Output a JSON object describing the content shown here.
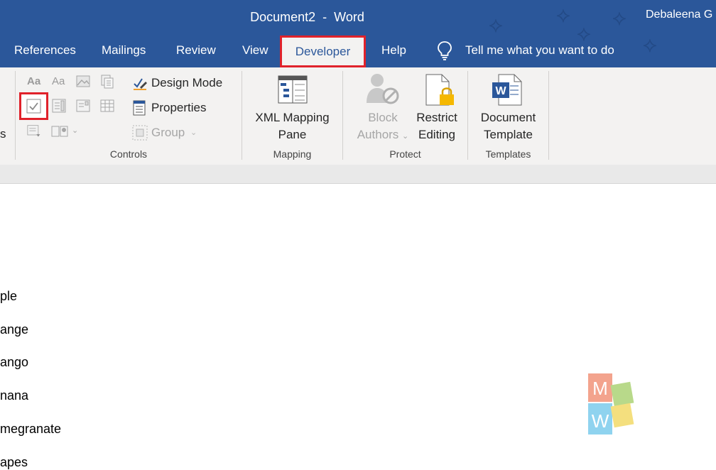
{
  "titlebar": {
    "document_title": "Document2  -  Word",
    "user": "Debaleena G"
  },
  "tabs": [
    "References",
    "Mailings",
    "Review",
    "View",
    "Developer",
    "Help"
  ],
  "active_tab": "Developer",
  "tell_me": "Tell me what you want to do",
  "ribbon": {
    "controls": {
      "label": "Controls",
      "design_mode": "Design Mode",
      "properties": "Properties",
      "group": "Group",
      "rich_text_label": "Aa",
      "plain_text_label": "Aa",
      "left_edge_text": "s"
    },
    "mapping": {
      "label": "Mapping",
      "xml_line1": "XML Mapping",
      "xml_line2": "Pane"
    },
    "protect": {
      "label": "Protect",
      "block_line1": "Block",
      "block_line2": "Authors",
      "restrict_line1": "Restrict",
      "restrict_line2": "Editing"
    },
    "templates": {
      "label": "Templates",
      "doc_line1": "Document",
      "doc_line2": "Template"
    }
  },
  "document": {
    "lines": [
      "ple",
      "ange",
      "ango",
      "nana",
      "megranate",
      "apes"
    ]
  },
  "watermark": {
    "letter1": "M",
    "letter2": "W"
  },
  "colors": {
    "accent": "#2b579a",
    "highlight": "#e0222b",
    "ribbon_bg": "#f3f2f1"
  },
  "icons": [
    "lightbulb-icon",
    "checkbox-content-control-icon",
    "design-mode-icon",
    "properties-icon",
    "group-icon",
    "xml-mapping-icon",
    "block-authors-icon",
    "restrict-editing-icon",
    "document-template-icon"
  ]
}
